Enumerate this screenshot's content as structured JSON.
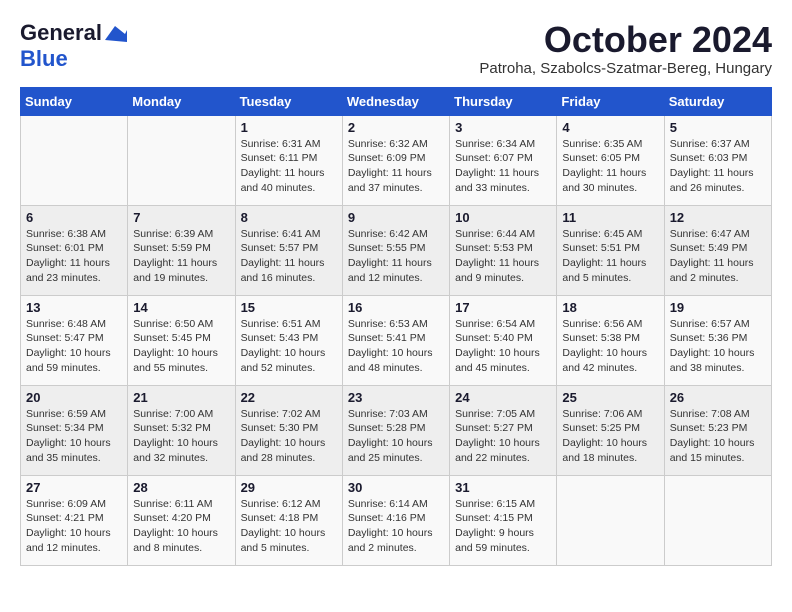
{
  "header": {
    "logo_line1": "General",
    "logo_line2": "Blue",
    "month": "October 2024",
    "location": "Patroha, Szabolcs-Szatmar-Bereg, Hungary"
  },
  "columns": [
    "Sunday",
    "Monday",
    "Tuesday",
    "Wednesday",
    "Thursday",
    "Friday",
    "Saturday"
  ],
  "weeks": [
    [
      {
        "day": "",
        "info": ""
      },
      {
        "day": "",
        "info": ""
      },
      {
        "day": "1",
        "info": "Sunrise: 6:31 AM\nSunset: 6:11 PM\nDaylight: 11 hours\nand 40 minutes."
      },
      {
        "day": "2",
        "info": "Sunrise: 6:32 AM\nSunset: 6:09 PM\nDaylight: 11 hours\nand 37 minutes."
      },
      {
        "day": "3",
        "info": "Sunrise: 6:34 AM\nSunset: 6:07 PM\nDaylight: 11 hours\nand 33 minutes."
      },
      {
        "day": "4",
        "info": "Sunrise: 6:35 AM\nSunset: 6:05 PM\nDaylight: 11 hours\nand 30 minutes."
      },
      {
        "day": "5",
        "info": "Sunrise: 6:37 AM\nSunset: 6:03 PM\nDaylight: 11 hours\nand 26 minutes."
      }
    ],
    [
      {
        "day": "6",
        "info": "Sunrise: 6:38 AM\nSunset: 6:01 PM\nDaylight: 11 hours\nand 23 minutes."
      },
      {
        "day": "7",
        "info": "Sunrise: 6:39 AM\nSunset: 5:59 PM\nDaylight: 11 hours\nand 19 minutes."
      },
      {
        "day": "8",
        "info": "Sunrise: 6:41 AM\nSunset: 5:57 PM\nDaylight: 11 hours\nand 16 minutes."
      },
      {
        "day": "9",
        "info": "Sunrise: 6:42 AM\nSunset: 5:55 PM\nDaylight: 11 hours\nand 12 minutes."
      },
      {
        "day": "10",
        "info": "Sunrise: 6:44 AM\nSunset: 5:53 PM\nDaylight: 11 hours\nand 9 minutes."
      },
      {
        "day": "11",
        "info": "Sunrise: 6:45 AM\nSunset: 5:51 PM\nDaylight: 11 hours\nand 5 minutes."
      },
      {
        "day": "12",
        "info": "Sunrise: 6:47 AM\nSunset: 5:49 PM\nDaylight: 11 hours\nand 2 minutes."
      }
    ],
    [
      {
        "day": "13",
        "info": "Sunrise: 6:48 AM\nSunset: 5:47 PM\nDaylight: 10 hours\nand 59 minutes."
      },
      {
        "day": "14",
        "info": "Sunrise: 6:50 AM\nSunset: 5:45 PM\nDaylight: 10 hours\nand 55 minutes."
      },
      {
        "day": "15",
        "info": "Sunrise: 6:51 AM\nSunset: 5:43 PM\nDaylight: 10 hours\nand 52 minutes."
      },
      {
        "day": "16",
        "info": "Sunrise: 6:53 AM\nSunset: 5:41 PM\nDaylight: 10 hours\nand 48 minutes."
      },
      {
        "day": "17",
        "info": "Sunrise: 6:54 AM\nSunset: 5:40 PM\nDaylight: 10 hours\nand 45 minutes."
      },
      {
        "day": "18",
        "info": "Sunrise: 6:56 AM\nSunset: 5:38 PM\nDaylight: 10 hours\nand 42 minutes."
      },
      {
        "day": "19",
        "info": "Sunrise: 6:57 AM\nSunset: 5:36 PM\nDaylight: 10 hours\nand 38 minutes."
      }
    ],
    [
      {
        "day": "20",
        "info": "Sunrise: 6:59 AM\nSunset: 5:34 PM\nDaylight: 10 hours\nand 35 minutes."
      },
      {
        "day": "21",
        "info": "Sunrise: 7:00 AM\nSunset: 5:32 PM\nDaylight: 10 hours\nand 32 minutes."
      },
      {
        "day": "22",
        "info": "Sunrise: 7:02 AM\nSunset: 5:30 PM\nDaylight: 10 hours\nand 28 minutes."
      },
      {
        "day": "23",
        "info": "Sunrise: 7:03 AM\nSunset: 5:28 PM\nDaylight: 10 hours\nand 25 minutes."
      },
      {
        "day": "24",
        "info": "Sunrise: 7:05 AM\nSunset: 5:27 PM\nDaylight: 10 hours\nand 22 minutes."
      },
      {
        "day": "25",
        "info": "Sunrise: 7:06 AM\nSunset: 5:25 PM\nDaylight: 10 hours\nand 18 minutes."
      },
      {
        "day": "26",
        "info": "Sunrise: 7:08 AM\nSunset: 5:23 PM\nDaylight: 10 hours\nand 15 minutes."
      }
    ],
    [
      {
        "day": "27",
        "info": "Sunrise: 6:09 AM\nSunset: 4:21 PM\nDaylight: 10 hours\nand 12 minutes."
      },
      {
        "day": "28",
        "info": "Sunrise: 6:11 AM\nSunset: 4:20 PM\nDaylight: 10 hours\nand 8 minutes."
      },
      {
        "day": "29",
        "info": "Sunrise: 6:12 AM\nSunset: 4:18 PM\nDaylight: 10 hours\nand 5 minutes."
      },
      {
        "day": "30",
        "info": "Sunrise: 6:14 AM\nSunset: 4:16 PM\nDaylight: 10 hours\nand 2 minutes."
      },
      {
        "day": "31",
        "info": "Sunrise: 6:15 AM\nSunset: 4:15 PM\nDaylight: 9 hours\nand 59 minutes."
      },
      {
        "day": "",
        "info": ""
      },
      {
        "day": "",
        "info": ""
      }
    ]
  ]
}
